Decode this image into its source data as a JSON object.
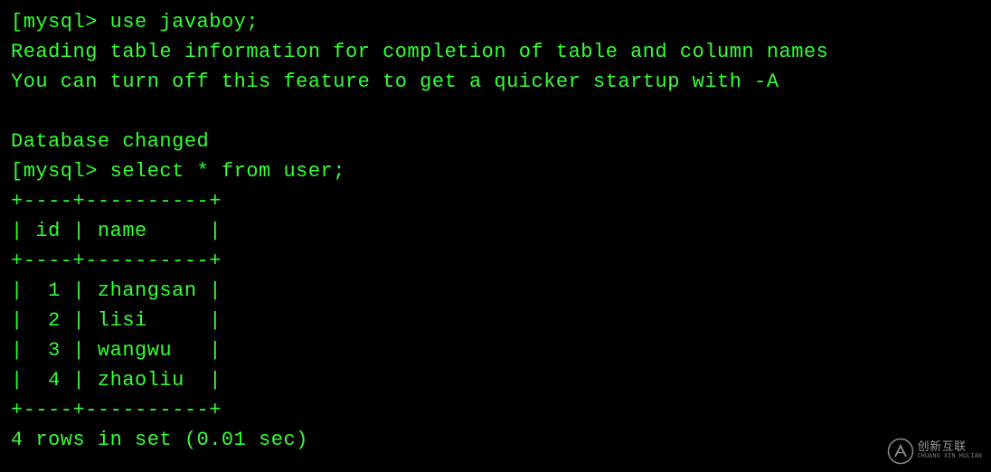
{
  "terminal": {
    "prompt": "mysql>",
    "bracket_open": "[",
    "command1": "use javaboy;",
    "info_line1": "Reading table information for completion of table and column names",
    "info_line2": "You can turn off this feature to get a quicker startup with -A",
    "db_changed": "Database changed",
    "command2": "select * from user;",
    "table_border": "+----+----------+",
    "table_header": "| id | name     |",
    "table_rows": [
      "|  1 | zhangsan |",
      "|  2 | lisi     |",
      "|  3 | wangwu   |",
      "|  4 | zhaoliu  |"
    ],
    "result_summary": "4 rows in set (0.01 sec)"
  },
  "chart_data": {
    "type": "table",
    "title": "user",
    "columns": [
      "id",
      "name"
    ],
    "rows": [
      {
        "id": 1,
        "name": "zhangsan"
      },
      {
        "id": 2,
        "name": "lisi"
      },
      {
        "id": 3,
        "name": "wangwu"
      },
      {
        "id": 4,
        "name": "zhaoliu"
      }
    ],
    "row_count": 4,
    "query_time_sec": 0.01,
    "database": "javaboy"
  },
  "watermark": {
    "brand": "创新互联",
    "sub": "CHUANG XIN HULIAN"
  }
}
